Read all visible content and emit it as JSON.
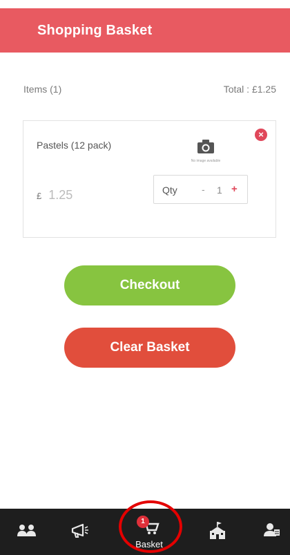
{
  "header": {
    "title": "Shopping Basket"
  },
  "summary": {
    "items_label": "Items (1)",
    "total_label": "Total :  £1.25"
  },
  "item": {
    "name": "Pastels (12 pack)",
    "currency": "£",
    "price": "1.25",
    "remove_icon": "×",
    "no_image_text": "No image available",
    "qty_label": "Qty",
    "qty_minus": "-",
    "qty_value": "1",
    "qty_plus": "+"
  },
  "buttons": {
    "checkout": "Checkout",
    "clear": "Clear Basket"
  },
  "nav": {
    "items": [
      {
        "icon": "people-icon"
      },
      {
        "icon": "megaphone-icon"
      },
      {
        "icon": "basket-icon",
        "label": "Basket",
        "badge": "1"
      },
      {
        "icon": "school-icon"
      },
      {
        "icon": "profile-icon"
      }
    ]
  },
  "colors": {
    "header": "#e85a61",
    "checkout": "#87c440",
    "clear": "#e14e3c",
    "nav_bg": "#1e1e1e",
    "highlight": "#e30000"
  }
}
